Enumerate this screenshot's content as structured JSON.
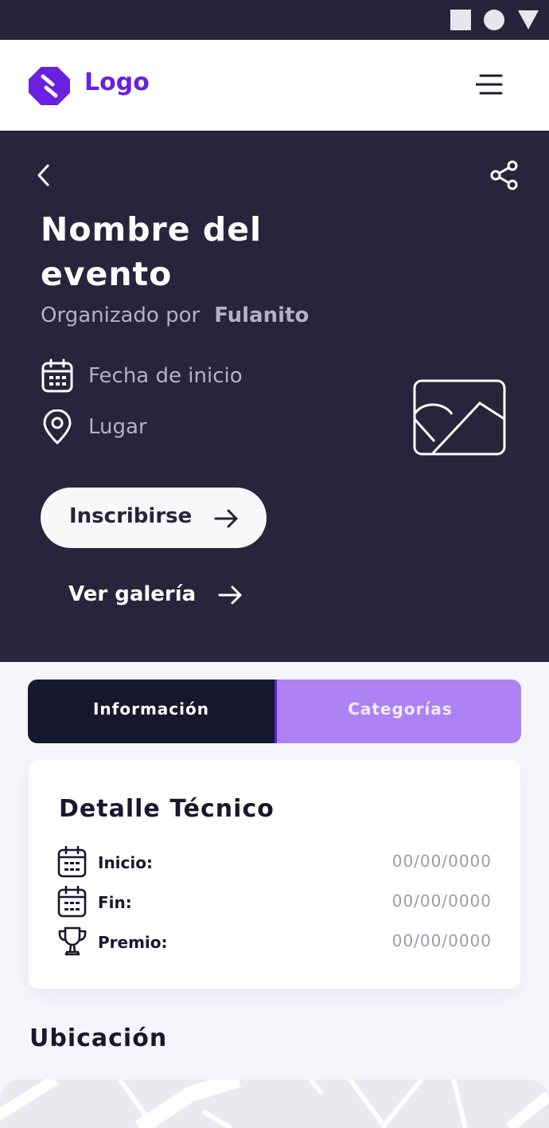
{
  "icons": {
    "status_square": "square-icon",
    "status_circle": "circle-icon",
    "status_triangle": "triangle-icon",
    "logo": "logo-mark-icon",
    "menu": "hamburger-menu-icon",
    "back": "chevron-left-icon",
    "share": "share-icon",
    "calendar": "calendar-icon",
    "location": "location-pin-icon",
    "image": "image-placeholder-icon",
    "arrow": "arrow-right-icon",
    "trophy": "trophy-icon"
  },
  "colors": {
    "brand": "#6B1FE0",
    "hero_bg": "#28243B",
    "tab_active_bg": "#17172E",
    "tab_inactive_bg": "#AD82F3"
  },
  "navbar": {
    "logo_text": "Logo"
  },
  "event": {
    "title": "Nombre del evento",
    "organized_by_label": "Organizado por",
    "organizer": "Fulanito",
    "start_date_label": "Fecha de inicio",
    "place_label": "Lugar",
    "register_label": "Inscribirse",
    "gallery_label": "Ver galería"
  },
  "tabs": [
    {
      "label": "Información",
      "active": true
    },
    {
      "label": "Categorías",
      "active": false
    }
  ],
  "details": {
    "title": "Detalle Técnico",
    "rows": [
      {
        "label": "Inicio:",
        "value": "00/00/0000",
        "icon": "calendar-icon"
      },
      {
        "label": "Fin:",
        "value": "00/00/0000",
        "icon": "calendar-icon"
      },
      {
        "label": "Premio:",
        "value": "00/00/0000",
        "icon": "trophy-icon"
      }
    ]
  },
  "location": {
    "title": "Ubicación"
  }
}
